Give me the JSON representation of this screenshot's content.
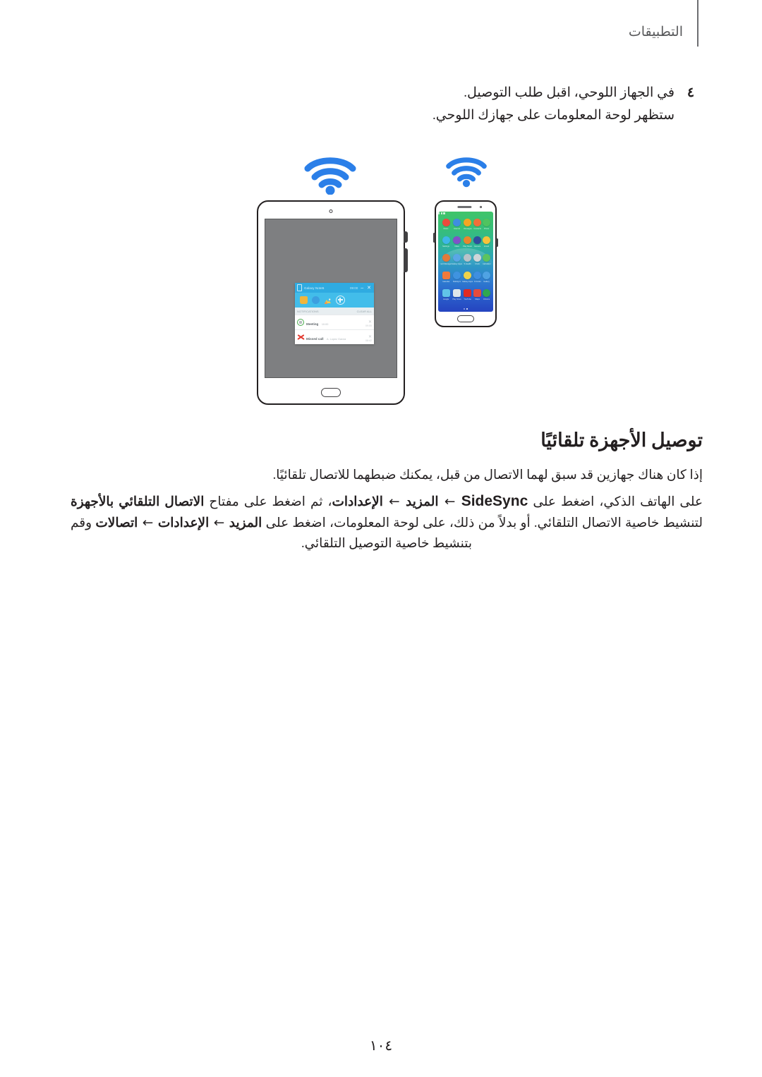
{
  "header": {
    "title": "التطبيقات"
  },
  "step": {
    "number": "٤",
    "line1": "في الجهاز اللوحي، اقبل طلب التوصيل.",
    "line2": "ستظهر لوحة المعلومات على جهازك اللوحي."
  },
  "illustration": {
    "tablet_wifi_icon": "wifi-icon",
    "phone_wifi_icon": "wifi-icon",
    "tablet": {
      "camera": "camera-dot",
      "home_button": "home-button",
      "notification_panel": {
        "device_name": "Galaxy Note5",
        "time": "09:00",
        "minimize_label": "–",
        "close_label": "✕",
        "popout_label": "popout-icon",
        "tools": [
          "folder-icon",
          "music-icon",
          "gallery-icon",
          "add-icon"
        ],
        "subbar_left": "NOTIFICATIONS",
        "subbar_right": "CLEAR ALL",
        "rows": [
          {
            "icon": "calendar-icon",
            "title": "Meeting",
            "subtitle": "10:00",
            "time": "09:00",
            "close": "✕"
          },
          {
            "icon": "missed-call-icon",
            "title": "Missed call",
            "subtitle": "A. Lopez Garcia",
            "time": "08:42",
            "close": "✕"
          }
        ]
      }
    },
    "phone": {
      "speaker": "speaker-grille",
      "camera": "camera-dot",
      "home_button": "home-button",
      "apps": [
        {
          "label": "Phone",
          "icon": "phone-icon",
          "color": "#4fc45f",
          "shape": "round"
        },
        {
          "label": "Contacts",
          "icon": "contacts-icon",
          "color": "#f0703a",
          "shape": "round"
        },
        {
          "label": "Messages",
          "icon": "messages-icon",
          "color": "#f5a623",
          "shape": "round"
        },
        {
          "label": "Internet",
          "icon": "internet-icon",
          "color": "#3f8ee0",
          "shape": "round"
        },
        {
          "label": "Music",
          "icon": "music-icon",
          "color": "#ec4b3c",
          "shape": "round"
        },
        {
          "label": "Email",
          "icon": "email-icon",
          "color": "#f7c23b",
          "shape": "round"
        },
        {
          "label": "Camera",
          "icon": "camera-icon",
          "color": "#2f4e9e",
          "shape": "round"
        },
        {
          "label": "Play Music",
          "icon": "play-music-icon",
          "color": "#e8872c",
          "shape": "round"
        },
        {
          "label": "Video",
          "icon": "video-icon",
          "color": "#7f52c9",
          "shape": "round"
        },
        {
          "label": "Settings",
          "icon": "settings-icon",
          "color": "#3fb7e8",
          "shape": "round"
        },
        {
          "label": "Calculator",
          "icon": "calculator-icon",
          "color": "#5cc45f",
          "shape": "round"
        },
        {
          "label": "Clock",
          "icon": "clock-icon",
          "color": "#cfd6d9",
          "shape": "round"
        },
        {
          "label": "S Health",
          "icon": "s-health-icon",
          "color": "#b8c3c9",
          "shape": "round"
        },
        {
          "label": "Galaxy Apps",
          "icon": "galaxy-apps-icon",
          "color": "#5aa7e6",
          "shape": "round"
        },
        {
          "label": "Smart Manager",
          "icon": "smart-manager-icon",
          "color": "#e07a3a",
          "shape": "round"
        },
        {
          "label": "Gallery",
          "icon": "gallery-icon",
          "color": "#4fa3e3",
          "shape": "round"
        },
        {
          "label": "S Finder",
          "icon": "s-finder-icon",
          "color": "#3e8fe0",
          "shape": "round"
        },
        {
          "label": "Galaxy Apps",
          "icon": "store-icon",
          "color": "#edd34a",
          "shape": "round"
        },
        {
          "label": "SideSync",
          "icon": "sidesync-icon",
          "color": "#3f93e0",
          "shape": "round"
        },
        {
          "label": "Calendar",
          "icon": "calendar-icon",
          "color": "#f07a3c",
          "shape": "sq"
        },
        {
          "label": "Chrome",
          "icon": "chrome-icon",
          "color": "#2fa84f",
          "shape": "round"
        },
        {
          "label": "Maps",
          "icon": "maps-icon",
          "color": "#e54b3c",
          "shape": "sq"
        },
        {
          "label": "YouTube",
          "icon": "youtube-icon",
          "color": "#e02a23",
          "shape": "sq"
        },
        {
          "label": "Play Store",
          "icon": "play-store-icon",
          "color": "#dfe6ea",
          "shape": "sq"
        },
        {
          "label": "Google",
          "icon": "google-folder-icon",
          "color": "#61c4e8",
          "shape": "sq"
        }
      ]
    }
  },
  "section": {
    "title": "توصيل الأجهزة تلقائيًا",
    "para1": "إذا كان هناك جهازين قد سبق لهما الاتصال من قبل، يمكنك ضبطهما للاتصال تلقائيًا.",
    "para2": {
      "t1": "على الهاتف الذكي، اضغط على ",
      "b1": "SideSync",
      "a1": " ← ",
      "b2": "المزيد",
      "a2": " ← ",
      "b3": "الإعدادات",
      "t2": "، ثم اضغط على مفتاح ",
      "b4": "الاتصال التلقائي بالأجهزة",
      "t3": " لتنشيط خاصية الاتصال التلقائي. أو بدلاً من ذلك، على لوحة المعلومات، اضغط على ",
      "b5": "المزيد",
      "a3": " ← ",
      "b6": "الإعدادات",
      "a4": " ← ",
      "b7": "اتصالات",
      "t4": " وقم بتنشيط خاصية التوصيل التلقائي."
    }
  },
  "footer": {
    "page_number": "١٠٤"
  },
  "colors": {
    "wifi_blue": "#2b7fe8",
    "panel_header": "#2fabe1",
    "panel_tools": "#42bdea",
    "tablet_screen": "#7e7f81",
    "text": "#231f20",
    "header_text": "#58595b"
  }
}
